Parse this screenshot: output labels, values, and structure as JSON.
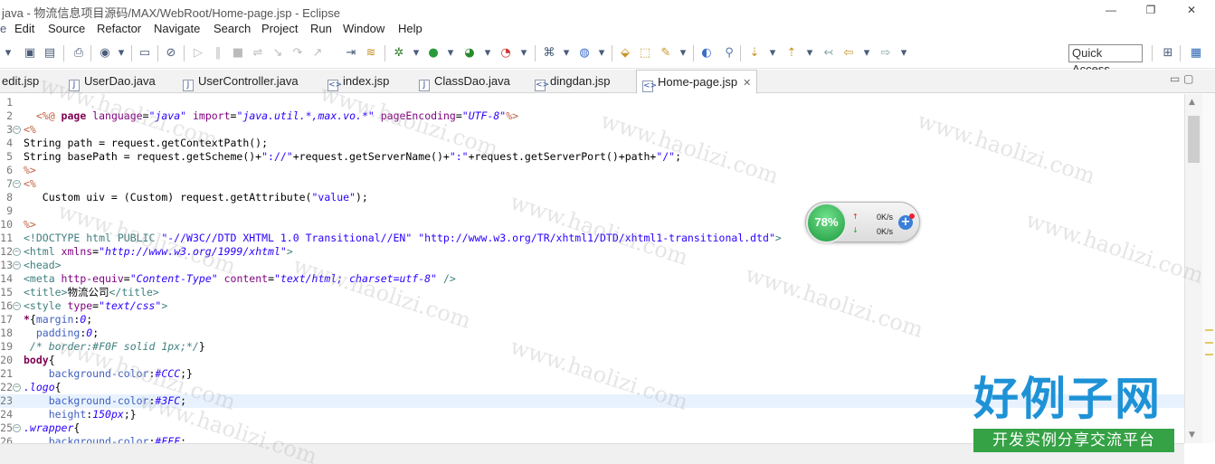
{
  "window": {
    "title": "java - 物流信息项目源码/MAX/WebRoot/Home-page.jsp - Eclipse",
    "minimize": "—",
    "restore": "❐",
    "close": "✕"
  },
  "menu": [
    "Edit",
    "Source",
    "Refactor",
    "Navigate",
    "Search",
    "Project",
    "Run",
    "Window",
    "Help"
  ],
  "toolbar": {
    "quick_access": "Quick Access"
  },
  "tabs": [
    {
      "label": "edit.jsp",
      "icon": "jsp-file-icon",
      "glyph": "<>"
    },
    {
      "label": "UserDao.java",
      "icon": "java-file-icon",
      "glyph": "J"
    },
    {
      "label": "UserController.java",
      "icon": "java-file-icon",
      "glyph": "J"
    },
    {
      "label": "index.jsp",
      "icon": "jsp-file-icon",
      "glyph": "<>"
    },
    {
      "label": "ClassDao.java",
      "icon": "java-file-icon",
      "glyph": "J"
    },
    {
      "label": "dingdan.jsp",
      "icon": "jsp-file-icon",
      "glyph": "<>"
    },
    {
      "label": "Home-page.jsp",
      "icon": "jsp-file-icon",
      "glyph": "<>",
      "active": true,
      "close": "✕"
    }
  ],
  "editor": {
    "current_line": 23,
    "lines": [
      {
        "n": "1",
        "fold": false,
        "parts": []
      },
      {
        "n": "2",
        "fold": false,
        "parts": [
          [
            "dl",
            "  <%@ "
          ],
          [
            "k",
            "page "
          ],
          [
            "a",
            "language"
          ],
          [
            "",
            "="
          ],
          [
            "s",
            "\"java\""
          ],
          [
            "",
            " "
          ],
          [
            "a",
            "import"
          ],
          [
            "",
            "="
          ],
          [
            "s",
            "\"java.util.*,max.vo.*\""
          ],
          [
            "",
            " "
          ],
          [
            "a",
            "pageEncoding"
          ],
          [
            "",
            "="
          ],
          [
            "s",
            "\"UTF-8\""
          ],
          [
            "dl",
            "%>"
          ]
        ]
      },
      {
        "n": "3",
        "fold": true,
        "parts": [
          [
            "dl",
            "<%"
          ]
        ]
      },
      {
        "n": "4",
        "fold": false,
        "parts": [
          [
            "",
            "String path = request.getContextPath();"
          ]
        ]
      },
      {
        "n": "5",
        "fold": false,
        "parts": [
          [
            "",
            "String basePath = request.getScheme()+"
          ],
          [
            "p",
            "\"://\""
          ],
          [
            "",
            "+request.getServerName()+"
          ],
          [
            "p",
            "\":\""
          ],
          [
            "",
            "+request.getServerPort()+path+"
          ],
          [
            "p",
            "\"/\""
          ],
          [
            "",
            ";"
          ]
        ]
      },
      {
        "n": "6",
        "fold": false,
        "parts": [
          [
            "dl",
            "%>"
          ]
        ]
      },
      {
        "n": "7",
        "fold": true,
        "parts": [
          [
            "dl",
            "<%"
          ]
        ]
      },
      {
        "n": "8",
        "fold": false,
        "parts": [
          [
            "",
            "   Custom uiv = (Custom) request.getAttribute("
          ],
          [
            "p",
            "\"value\""
          ],
          [
            "",
            ");"
          ]
        ]
      },
      {
        "n": "9",
        "fold": false,
        "parts": []
      },
      {
        "n": "10",
        "fold": false,
        "parts": [
          [
            "dl",
            "%>"
          ]
        ]
      },
      {
        "n": "11",
        "fold": false,
        "parts": [
          [
            "t",
            "<!DOCTYPE html PUBLIC "
          ],
          [
            "p",
            "\"-//W3C//DTD XHTML 1.0 Transitional//EN\""
          ],
          [
            "",
            " "
          ],
          [
            "p",
            "\"http://www.w3.org/TR/xhtml1/DTD/xhtml1-transitional.dtd\""
          ],
          [
            "t",
            ">"
          ]
        ]
      },
      {
        "n": "12",
        "fold": true,
        "parts": [
          [
            "t",
            "<html "
          ],
          [
            "a",
            "xmlns"
          ],
          [
            "",
            "="
          ],
          [
            "s",
            "\"http://www.w3.org/1999/xhtml\""
          ],
          [
            "t",
            ">"
          ]
        ]
      },
      {
        "n": "13",
        "fold": true,
        "parts": [
          [
            "t",
            "<head>"
          ]
        ]
      },
      {
        "n": "14",
        "fold": false,
        "parts": [
          [
            "t",
            "<meta "
          ],
          [
            "a",
            "http-equiv"
          ],
          [
            "",
            "="
          ],
          [
            "s",
            "\"Content-Type\""
          ],
          [
            "",
            " "
          ],
          [
            "a",
            "content"
          ],
          [
            "",
            "="
          ],
          [
            "s",
            "\"text/html; charset=utf-8\""
          ],
          [
            "t",
            " />"
          ]
        ]
      },
      {
        "n": "15",
        "fold": false,
        "parts": [
          [
            "t",
            "<title>"
          ],
          [
            "",
            "物流公司"
          ],
          [
            "t",
            "</title>"
          ]
        ]
      },
      {
        "n": "16",
        "fold": true,
        "parts": [
          [
            "t",
            "<style "
          ],
          [
            "a",
            "type"
          ],
          [
            "",
            "="
          ],
          [
            "s",
            "\"text/css\""
          ],
          [
            "t",
            ">"
          ]
        ]
      },
      {
        "n": "17",
        "fold": false,
        "parts": [
          [
            "k",
            "*"
          ],
          [
            "",
            "{"
          ],
          [
            "cm",
            "margin"
          ],
          [
            "",
            ":"
          ],
          [
            "s",
            "0"
          ],
          [
            "",
            ";"
          ]
        ]
      },
      {
        "n": "18",
        "fold": false,
        "parts": [
          [
            "",
            "  "
          ],
          [
            "cm",
            "padding"
          ],
          [
            "",
            ":"
          ],
          [
            "s",
            "0"
          ],
          [
            "",
            ";"
          ]
        ]
      },
      {
        "n": "19",
        "fold": false,
        "parts": [
          [
            "cs",
            " /* border:#F0F solid 1px;*/"
          ],
          [
            "",
            "}"
          ]
        ]
      },
      {
        "n": "20",
        "fold": false,
        "parts": [
          [
            "k",
            "body"
          ],
          [
            "",
            "{"
          ]
        ]
      },
      {
        "n": "21",
        "fold": false,
        "parts": [
          [
            "",
            "    "
          ],
          [
            "cm",
            "background-color"
          ],
          [
            "",
            ":"
          ],
          [
            "s",
            "#CCC"
          ],
          [
            "",
            ";}"
          ]
        ]
      },
      {
        "n": "22",
        "fold": true,
        "parts": [
          [
            "s",
            ".logo"
          ],
          [
            "",
            "{"
          ]
        ]
      },
      {
        "n": "23",
        "fold": false,
        "parts": [
          [
            "",
            "    "
          ],
          [
            "cm",
            "background-color"
          ],
          [
            "",
            ":"
          ],
          [
            "s",
            "#3FC"
          ],
          [
            "",
            ";"
          ]
        ]
      },
      {
        "n": "24",
        "fold": false,
        "parts": [
          [
            "",
            "    "
          ],
          [
            "cm",
            "height"
          ],
          [
            "",
            ":"
          ],
          [
            "s",
            "150px"
          ],
          [
            "",
            ";}"
          ]
        ]
      },
      {
        "n": "25",
        "fold": true,
        "parts": [
          [
            "s",
            ".wrapper"
          ],
          [
            "",
            "{"
          ]
        ]
      },
      {
        "n": "26",
        "fold": false,
        "parts": [
          [
            "",
            "    "
          ],
          [
            "cm",
            "background-color"
          ],
          [
            "",
            ":"
          ],
          [
            "s",
            "#FFF"
          ],
          [
            "",
            ";"
          ]
        ]
      }
    ]
  },
  "net_widget": {
    "percent": "78%",
    "up_rate": "0K/s",
    "down_rate": "0K/s",
    "up_arrow": "↑",
    "down_arrow": "↓",
    "plus": "+"
  },
  "watermark": {
    "text": "www.haolizi.com",
    "brand_big": "好例子网",
    "brand_small": "开发实例分享交流平台"
  }
}
